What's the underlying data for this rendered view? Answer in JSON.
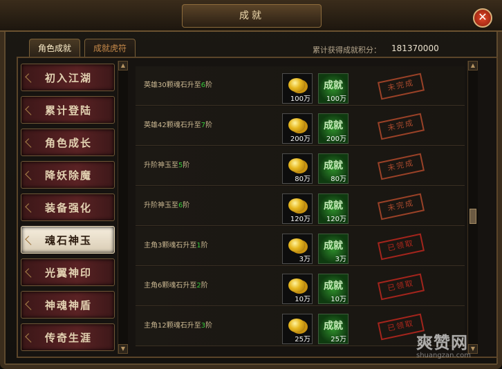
{
  "window": {
    "title": "成就"
  },
  "tabs": [
    {
      "label": "角色成就",
      "active": true
    },
    {
      "label": "成就虎符",
      "active": false
    }
  ],
  "score": {
    "label": "累计获得成就积分：",
    "value": "181370000"
  },
  "sidebar": {
    "items": [
      {
        "label": "初入江湖",
        "active": false
      },
      {
        "label": "累计登陆",
        "active": false
      },
      {
        "label": "角色成长",
        "active": false
      },
      {
        "label": "降妖除魔",
        "active": false
      },
      {
        "label": "装备强化",
        "active": false
      },
      {
        "label": "魂石神玉",
        "active": true
      },
      {
        "label": "光翼神印",
        "active": false
      },
      {
        "label": "神魂神盾",
        "active": false
      },
      {
        "label": "传奇生涯",
        "active": false
      }
    ]
  },
  "achievements": [
    {
      "desc_prefix": "英雄30颗魂石升至",
      "desc_num": "6",
      "desc_suffix": "阶",
      "gold": "100万",
      "points_label": "成就",
      "points": "100万",
      "status": "未完成",
      "status_type": "incomplete"
    },
    {
      "desc_prefix": "英雄42颗魂石升至",
      "desc_num": "7",
      "desc_suffix": "阶",
      "gold": "200万",
      "points_label": "成就",
      "points": "200万",
      "status": "未完成",
      "status_type": "incomplete"
    },
    {
      "desc_prefix": "升阶神玉至",
      "desc_num": "5",
      "desc_suffix": "阶",
      "gold": "80万",
      "points_label": "成就",
      "points": "80万",
      "status": "未完成",
      "status_type": "incomplete"
    },
    {
      "desc_prefix": "升阶神玉至",
      "desc_num": "6",
      "desc_suffix": "阶",
      "gold": "120万",
      "points_label": "成就",
      "points": "120万",
      "status": "未完成",
      "status_type": "incomplete"
    },
    {
      "desc_prefix": "主角3颗魂石升至",
      "desc_num": "1",
      "desc_suffix": "阶",
      "gold": "3万",
      "points_label": "成就",
      "points": "3万",
      "status": "已领取",
      "status_type": "claimed"
    },
    {
      "desc_prefix": "主角6颗魂石升至",
      "desc_num": "2",
      "desc_suffix": "阶",
      "gold": "10万",
      "points_label": "成就",
      "points": "10万",
      "status": "已领取",
      "status_type": "claimed"
    },
    {
      "desc_prefix": "主角12颗魂石升至",
      "desc_num": "3",
      "desc_suffix": "阶",
      "gold": "25万",
      "points_label": "成就",
      "points": "25万",
      "status": "已领取",
      "status_type": "claimed"
    }
  ],
  "watermark": {
    "logo": "爽赞网",
    "url": "shuangzan.com"
  }
}
